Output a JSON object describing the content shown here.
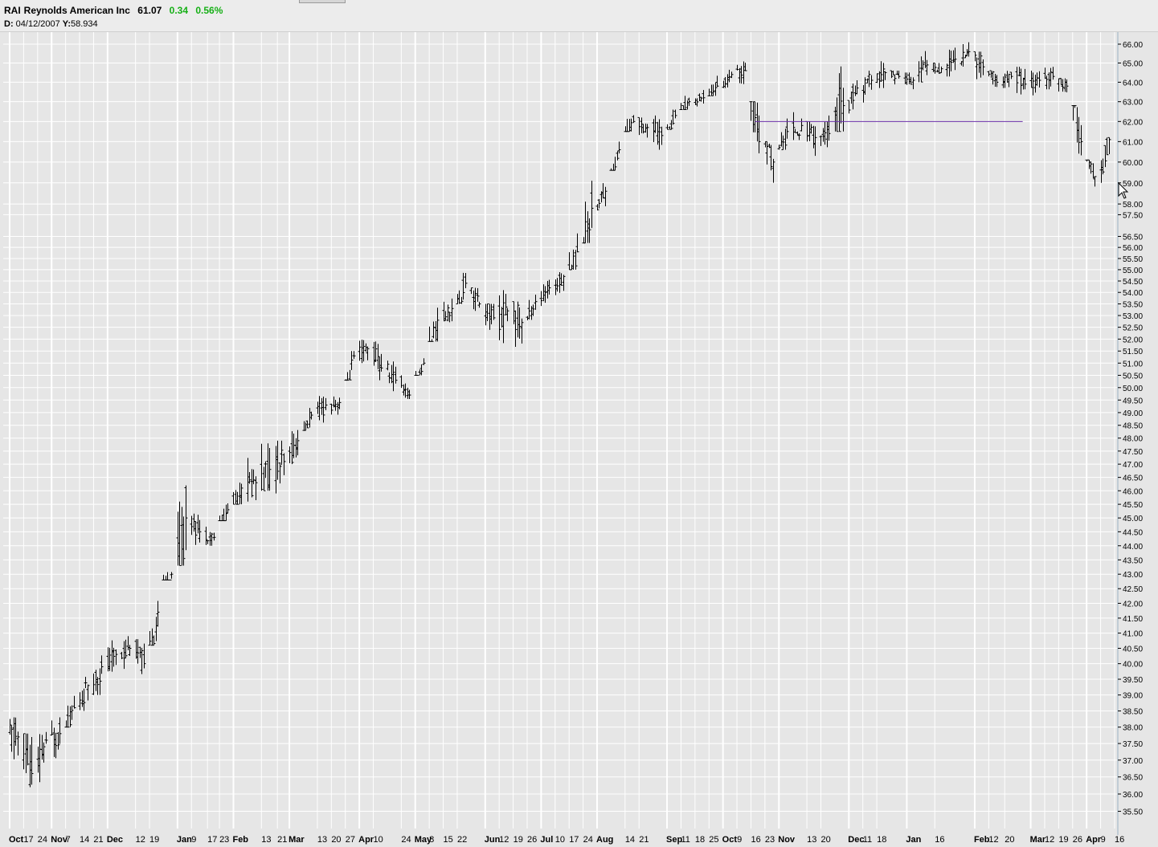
{
  "header": {
    "symbol": "RAI",
    "company": "Reynolds American Inc",
    "last": "61.07",
    "change": "0.34",
    "change_pct": "0.56%",
    "cursor_date_label": "D:",
    "cursor_date": "04/12/2007",
    "cursor_y_label": "Y:",
    "cursor_y": "58.934"
  },
  "colors": {
    "up": "#16b016",
    "bars": "#000000",
    "trendline": "#6a2fa8",
    "grid": "#ffffff",
    "background": "#e6e6e6"
  },
  "chart_data": {
    "type": "ohlc",
    "symbol": "RAI",
    "start_date": "2005-10-10",
    "ylim": [
      35.1,
      66.3
    ],
    "y_scale": "log",
    "y_ticks": [
      35.5,
      36,
      36.5,
      37,
      37.5,
      38,
      38.5,
      39,
      39.5,
      40,
      40.5,
      41,
      41.5,
      42,
      42.5,
      43,
      43.5,
      44,
      44.5,
      45,
      45.5,
      46,
      46.5,
      47,
      47.5,
      48,
      48.5,
      49,
      49.5,
      50,
      50.5,
      51,
      51.5,
      52,
      52.5,
      53,
      53.5,
      54,
      54.5,
      55,
      55.5,
      56,
      56.5,
      57.5,
      58,
      59,
      60,
      61,
      62,
      63,
      64,
      65,
      66
    ],
    "x_labels": [
      {
        "text": "Oct",
        "date": "2005-10-10",
        "month": true
      },
      {
        "text": "17",
        "date": "2005-10-17"
      },
      {
        "text": "24",
        "date": "2005-10-24"
      },
      {
        "text": "Nov",
        "date": "2005-10-31",
        "month": true
      },
      {
        "text": "7",
        "date": "2005-11-07"
      },
      {
        "text": "14",
        "date": "2005-11-14"
      },
      {
        "text": "21",
        "date": "2005-11-21"
      },
      {
        "text": "Dec",
        "date": "2005-11-28",
        "month": true
      },
      {
        "text": "12",
        "date": "2005-12-12"
      },
      {
        "text": "19",
        "date": "2005-12-19"
      },
      {
        "text": "Jan",
        "date": "2006-01-02",
        "month": true
      },
      {
        "text": "9",
        "date": "2006-01-09"
      },
      {
        "text": "17",
        "date": "2006-01-17"
      },
      {
        "text": "23",
        "date": "2006-01-23"
      },
      {
        "text": "Feb",
        "date": "2006-01-30",
        "month": true
      },
      {
        "text": "13",
        "date": "2006-02-13"
      },
      {
        "text": "21",
        "date": "2006-02-21"
      },
      {
        "text": "Mar",
        "date": "2006-02-27",
        "month": true
      },
      {
        "text": "13",
        "date": "2006-03-13"
      },
      {
        "text": "20",
        "date": "2006-03-20"
      },
      {
        "text": "27",
        "date": "2006-03-27"
      },
      {
        "text": "Apr",
        "date": "2006-04-03",
        "month": true
      },
      {
        "text": "10",
        "date": "2006-04-10"
      },
      {
        "text": "24",
        "date": "2006-04-24"
      },
      {
        "text": "May",
        "date": "2006-05-01",
        "month": true
      },
      {
        "text": "8",
        "date": "2006-05-08"
      },
      {
        "text": "15",
        "date": "2006-05-15"
      },
      {
        "text": "22",
        "date": "2006-05-22"
      },
      {
        "text": "Jun",
        "date": "2006-06-05",
        "month": true
      },
      {
        "text": "12",
        "date": "2006-06-12"
      },
      {
        "text": "19",
        "date": "2006-06-19"
      },
      {
        "text": "26",
        "date": "2006-06-26"
      },
      {
        "text": "Jul",
        "date": "2006-07-03",
        "month": true
      },
      {
        "text": "10",
        "date": "2006-07-10"
      },
      {
        "text": "17",
        "date": "2006-07-17"
      },
      {
        "text": "24",
        "date": "2006-07-24"
      },
      {
        "text": "Aug",
        "date": "2006-07-31",
        "month": true
      },
      {
        "text": "14",
        "date": "2006-08-14"
      },
      {
        "text": "21",
        "date": "2006-08-21"
      },
      {
        "text": "Sep",
        "date": "2006-09-04",
        "month": true
      },
      {
        "text": "11",
        "date": "2006-09-11"
      },
      {
        "text": "18",
        "date": "2006-09-18"
      },
      {
        "text": "25",
        "date": "2006-09-25"
      },
      {
        "text": "Oct",
        "date": "2006-10-02",
        "month": true
      },
      {
        "text": "9",
        "date": "2006-10-09"
      },
      {
        "text": "16",
        "date": "2006-10-16"
      },
      {
        "text": "23",
        "date": "2006-10-23"
      },
      {
        "text": "Nov",
        "date": "2006-10-30",
        "month": true
      },
      {
        "text": "13",
        "date": "2006-11-13"
      },
      {
        "text": "20",
        "date": "2006-11-20"
      },
      {
        "text": "Dec",
        "date": "2006-12-04",
        "month": true
      },
      {
        "text": "11",
        "date": "2006-12-11"
      },
      {
        "text": "18",
        "date": "2006-12-18"
      },
      {
        "text": "Jan",
        "date": "2007-01-02",
        "month": true
      },
      {
        "text": "16",
        "date": "2007-01-16"
      },
      {
        "text": "Feb",
        "date": "2007-02-05",
        "month": true
      },
      {
        "text": "12",
        "date": "2007-02-12"
      },
      {
        "text": "20",
        "date": "2007-02-20"
      },
      {
        "text": "Mar",
        "date": "2007-03-05",
        "month": true
      },
      {
        "text": "12",
        "date": "2007-03-12"
      },
      {
        "text": "19",
        "date": "2007-03-19"
      },
      {
        "text": "26",
        "date": "2007-03-26"
      },
      {
        "text": "Apr",
        "date": "2007-04-02",
        "month": true
      },
      {
        "text": "9",
        "date": "2007-04-09"
      },
      {
        "text": "16",
        "date": "2007-04-16"
      }
    ],
    "grid": true,
    "series": [
      {
        "type": "ohlc",
        "weekly_closes": [
          37.7,
          36.6,
          37.6,
          37.8,
          38.6,
          39.3,
          39.9,
          40.3,
          40.5,
          40.0,
          41.7,
          43.0,
          45.0,
          44.5,
          44.3,
          45.3,
          46.1,
          46.3,
          46.8,
          47.1,
          47.9,
          48.9,
          49.3,
          49.4,
          51.3,
          51.6,
          50.8,
          50.3,
          49.7,
          51.0,
          52.8,
          53.3,
          54.4,
          53.5,
          52.9,
          53.2,
          52.7,
          53.6,
          54.2,
          54.7,
          55.8,
          57.8,
          58.6,
          60.6,
          62.0,
          61.7,
          61.3,
          62.3,
          63.0,
          63.2,
          63.8,
          64.4,
          64.6,
          61.0,
          60.0,
          61.5,
          61.8,
          61.2,
          61.4,
          62.8,
          63.7,
          64.1,
          64.5,
          64.3,
          64.1,
          64.9,
          64.7,
          65.2,
          65.6,
          64.8,
          64.0,
          64.3,
          63.9,
          64.1,
          64.3,
          63.8,
          61.0,
          59.3,
          61.1
        ],
        "weekly_ranges": [
          [
            36.5,
            38.3
          ],
          [
            35.3,
            37.8
          ],
          [
            36.3,
            38.0
          ],
          [
            37.0,
            38.3
          ],
          [
            38.0,
            39.0
          ],
          [
            38.5,
            39.8
          ],
          [
            39.0,
            40.6
          ],
          [
            39.5,
            40.8
          ],
          [
            39.6,
            40.9
          ],
          [
            39.4,
            40.8
          ],
          [
            40.6,
            42.3
          ],
          [
            42.8,
            43.6
          ],
          [
            43.3,
            47.8
          ],
          [
            44.0,
            45.3
          ],
          [
            44.0,
            45.0
          ],
          [
            44.9,
            45.9
          ],
          [
            45.5,
            47.0
          ],
          [
            45.6,
            47.8
          ],
          [
            46.0,
            48.6
          ],
          [
            45.9,
            47.9
          ],
          [
            47.0,
            48.5
          ],
          [
            48.3,
            49.4
          ],
          [
            48.6,
            49.9
          ],
          [
            48.8,
            49.8
          ],
          [
            50.3,
            51.5
          ],
          [
            51.0,
            52.3
          ],
          [
            50.3,
            51.9
          ],
          [
            49.8,
            51.1
          ],
          [
            49.4,
            50.5
          ],
          [
            50.5,
            51.2
          ],
          [
            51.9,
            53.8
          ],
          [
            52.6,
            53.9
          ],
          [
            53.5,
            55.2
          ],
          [
            52.8,
            54.2
          ],
          [
            51.6,
            53.5
          ],
          [
            51.8,
            54.1
          ],
          [
            51.2,
            53.6
          ],
          [
            52.8,
            53.9
          ],
          [
            53.4,
            54.6
          ],
          [
            53.8,
            55.0
          ],
          [
            55.0,
            56.8
          ],
          [
            56.2,
            59.1
          ],
          [
            57.7,
            59.0
          ],
          [
            59.6,
            61.0
          ],
          [
            61.5,
            63.4
          ],
          [
            60.8,
            62.2
          ],
          [
            60.6,
            62.3
          ],
          [
            61.6,
            62.6
          ],
          [
            62.6,
            63.6
          ],
          [
            62.7,
            63.6
          ],
          [
            63.3,
            64.5
          ],
          [
            63.7,
            64.8
          ],
          [
            63.8,
            65.1
          ],
          [
            59.9,
            63.0
          ],
          [
            58.5,
            61.0
          ],
          [
            60.6,
            62.8
          ],
          [
            60.9,
            62.7
          ],
          [
            60.3,
            62.0
          ],
          [
            60.3,
            62.3
          ],
          [
            61.5,
            66.3
          ],
          [
            62.4,
            64.1
          ],
          [
            62.9,
            64.6
          ],
          [
            63.7,
            65.5
          ],
          [
            63.5,
            64.6
          ],
          [
            63.2,
            64.5
          ],
          [
            64.0,
            65.8
          ],
          [
            63.9,
            65.0
          ],
          [
            64.3,
            66.1
          ],
          [
            64.6,
            66.1
          ],
          [
            63.7,
            65.6
          ],
          [
            63.5,
            64.6
          ],
          [
            63.7,
            64.7
          ],
          [
            63.1,
            64.8
          ],
          [
            63.3,
            64.6
          ],
          [
            63.4,
            64.8
          ],
          [
            63.0,
            64.2
          ],
          [
            59.8,
            62.8
          ],
          [
            58.6,
            60.1
          ],
          [
            59.0,
            61.2
          ]
        ]
      }
    ],
    "trendline": {
      "from": {
        "date": "2006-10-18",
        "y": 62.0
      },
      "to": {
        "date": "2007-03-01",
        "y": 62.0
      }
    }
  }
}
